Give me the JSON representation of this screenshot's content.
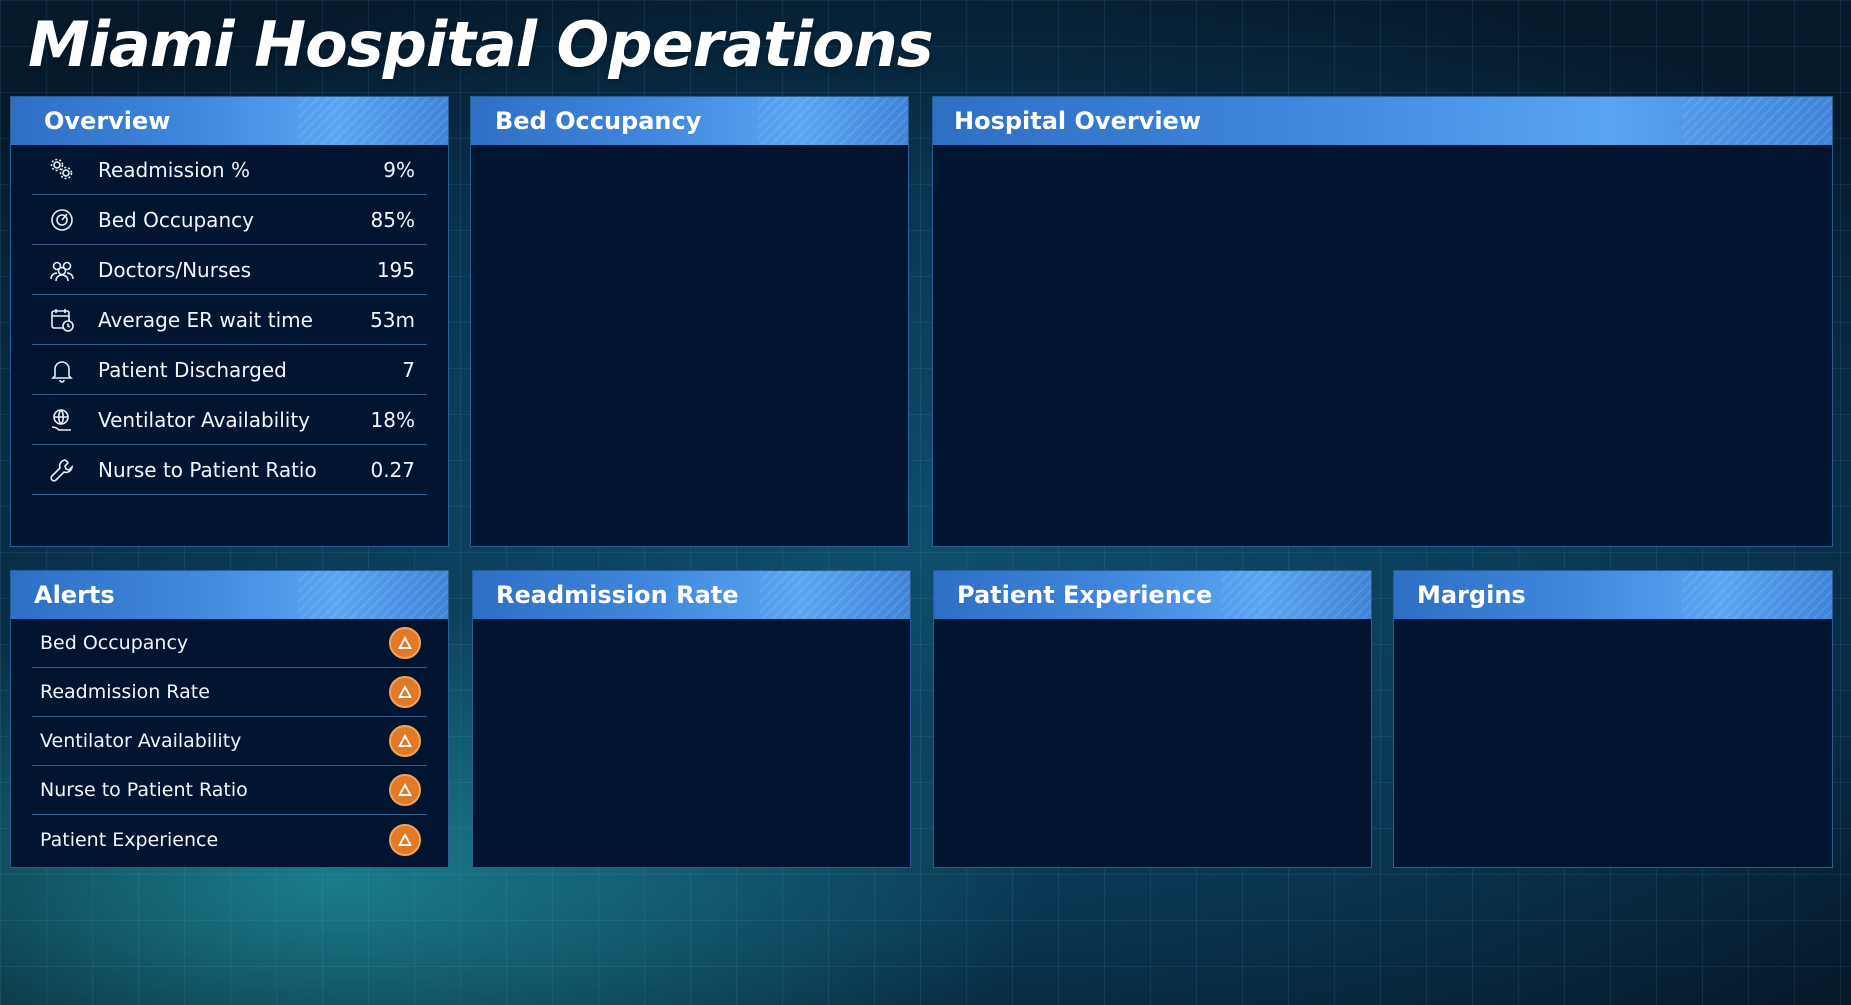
{
  "page": {
    "title": "Miami Hospital Operations"
  },
  "overview": {
    "header": "Overview",
    "items": [
      {
        "icon": "gears-icon",
        "label": "Readmission %",
        "value": "9%"
      },
      {
        "icon": "gauge-icon",
        "label": "Bed Occupancy",
        "value": "85%"
      },
      {
        "icon": "people-icon",
        "label": "Doctors/Nurses",
        "value": "195"
      },
      {
        "icon": "calendar-clock-icon",
        "label": "Average ER wait time",
        "value": "53m"
      },
      {
        "icon": "bell-icon",
        "label": "Patient Discharged",
        "value": "7"
      },
      {
        "icon": "globe-hand-icon",
        "label": "Ventilator Availability",
        "value": "18%"
      },
      {
        "icon": "wrench-icon",
        "label": "Nurse to Patient Ratio",
        "value": "0.27"
      }
    ]
  },
  "alerts": {
    "header": "Alerts",
    "items": [
      {
        "label": "Bed Occupancy",
        "icon": "warning-icon"
      },
      {
        "label": "Readmission Rate",
        "icon": "warning-icon"
      },
      {
        "label": "Ventilator Availability",
        "icon": "warning-icon"
      },
      {
        "label": "Nurse to Patient Ratio",
        "icon": "warning-icon"
      },
      {
        "label": "Patient Experience",
        "icon": "warning-icon"
      }
    ]
  },
  "panels": {
    "bed_occupancy": "Bed Occupancy",
    "hospital_overview": "Hospital Overview",
    "readmission_rate": "Readmission Rate",
    "patient_experience": "Patient Experience",
    "margins": "Margins"
  },
  "colors": {
    "panel_bg": "#011530",
    "header_gradient_start": "#2e6fc4",
    "header_gradient_end": "#5aa5f2",
    "alert_orange": "#e07a26"
  }
}
